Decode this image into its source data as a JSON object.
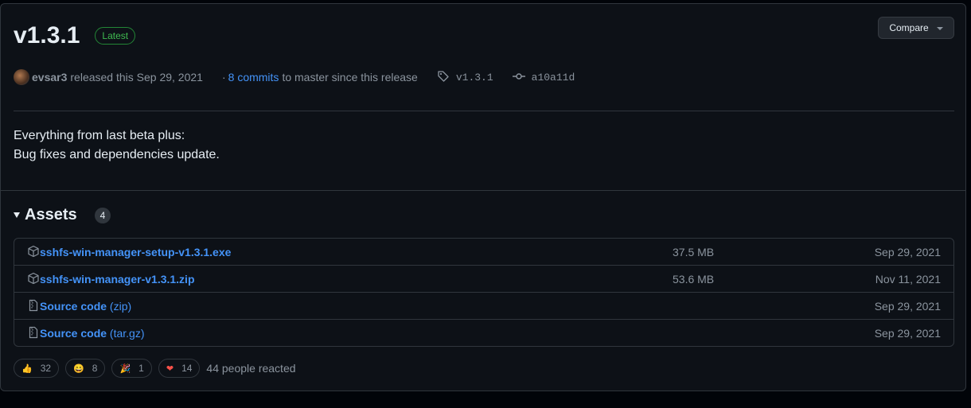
{
  "release": {
    "title": "v1.3.1",
    "badge": "Latest",
    "compare_label": "Compare",
    "author": "evsar3",
    "released_text": "released this Sep 29, 2021",
    "commits_prefix": "·",
    "commits_link": "8 commits",
    "commits_suffix": "to master since this release",
    "tag": "v1.3.1",
    "commit_sha": "a10a11d",
    "body_lines": [
      "Everything from last beta plus:",
      "Bug fixes and dependencies update."
    ]
  },
  "assets": {
    "title": "Assets",
    "count": "4",
    "rows": [
      {
        "icon": "package-icon",
        "name": "sshfs-win-manager-setup-v1.3.1.exe",
        "sub": "",
        "size": "37.5 MB",
        "date": "Sep 29, 2021"
      },
      {
        "icon": "package-icon",
        "name": "sshfs-win-manager-v1.3.1.zip",
        "sub": "",
        "size": "53.6 MB",
        "date": "Nov 11, 2021"
      },
      {
        "icon": "file-zip-icon",
        "name": "Source code",
        "sub": "(zip)",
        "size": "",
        "date": "Sep 29, 2021"
      },
      {
        "icon": "file-zip-icon",
        "name": "Source code",
        "sub": "(tar.gz)",
        "size": "",
        "date": "Sep 29, 2021"
      }
    ]
  },
  "reactions": {
    "items": [
      {
        "emoji": "👍",
        "count": "32"
      },
      {
        "emoji": "😄",
        "count": "8"
      },
      {
        "emoji": "🎉",
        "count": "1"
      },
      {
        "emoji": "❤",
        "count": "14"
      }
    ],
    "summary": "44 people reacted"
  }
}
